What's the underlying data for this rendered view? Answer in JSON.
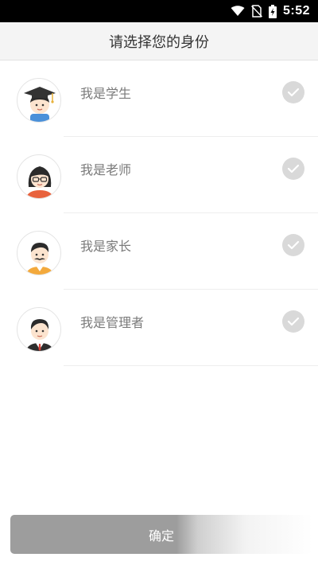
{
  "status_bar": {
    "time": "5:52",
    "icons": [
      "wifi-icon",
      "no-sim-icon",
      "battery-charging-icon"
    ]
  },
  "header": {
    "title": "请选择您的身份"
  },
  "roles": [
    {
      "label": "我是学生",
      "avatar": "student-avatar-icon",
      "selected": false
    },
    {
      "label": "我是老师",
      "avatar": "teacher-avatar-icon",
      "selected": false
    },
    {
      "label": "我是家长",
      "avatar": "parent-avatar-icon",
      "selected": false
    },
    {
      "label": "我是管理者",
      "avatar": "manager-avatar-icon",
      "selected": false
    }
  ],
  "footer": {
    "confirm_label": "确定"
  },
  "colors": {
    "check_unselected": "#d9d9d9",
    "button_bg": "#9d9d9d",
    "title_bar_bg": "#f4f4f4"
  }
}
